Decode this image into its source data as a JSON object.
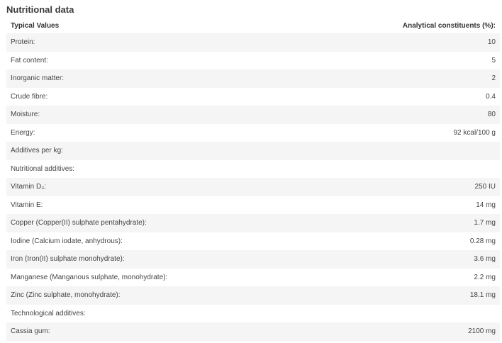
{
  "title": "Nutritional data",
  "table": {
    "headers": [
      "Typical Values",
      "Analytical constituents (%):"
    ],
    "rows": [
      {
        "label": "Protein:",
        "value": "10"
      },
      {
        "label": "Fat content:",
        "value": "5"
      },
      {
        "label": "Inorganic matter:",
        "value": "2"
      },
      {
        "label": "Crude fibre:",
        "value": "0.4"
      },
      {
        "label": "Moisture:",
        "value": "80"
      },
      {
        "label": "Energy:",
        "value": "92 kcal/100 g"
      },
      {
        "label": "Additives per kg:",
        "value": ""
      },
      {
        "label": "Nutritional additives:",
        "value": ""
      },
      {
        "label": "Vitamin D₃:",
        "value": "250 IU"
      },
      {
        "label": "Vitamin E:",
        "value": "14 mg"
      },
      {
        "label": "Copper (Copper(II) sulphate pentahydrate):",
        "value": "1.7 mg"
      },
      {
        "label": "Iodine (Calcium iodate, anhydrous):",
        "value": "0.28 mg"
      },
      {
        "label": "Iron (Iron(II) sulphate monohydrate):",
        "value": "3.6 mg"
      },
      {
        "label": "Manganese (Manganous sulphate, monohydrate):",
        "value": "2.2 mg"
      },
      {
        "label": "Zinc (Zinc sulphate, monohydrate):",
        "value": "18.1 mg"
      },
      {
        "label": "Technological additives:",
        "value": ""
      },
      {
        "label": "Cassia gum:",
        "value": "2100 mg"
      }
    ]
  }
}
